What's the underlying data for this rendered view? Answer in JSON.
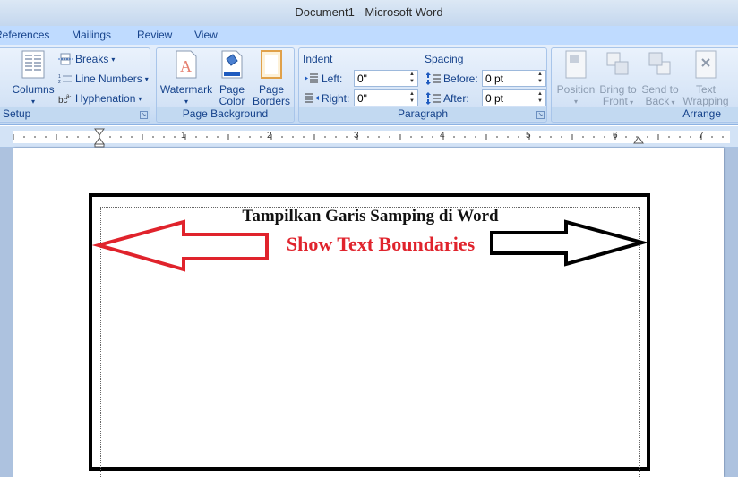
{
  "window": {
    "title": "Document1 - Microsoft Word"
  },
  "tabs": [
    "References",
    "Mailings",
    "Review",
    "View"
  ],
  "ribbon": {
    "page_setup": {
      "label": "Setup",
      "columns": "Columns",
      "breaks": "Breaks",
      "line_numbers": "Line Numbers",
      "hyphenation": "Hyphenation"
    },
    "page_background": {
      "label": "Page Background",
      "watermark": "Watermark",
      "page_color_1": "Page",
      "page_color_2": "Color",
      "page_borders_1": "Page",
      "page_borders_2": "Borders"
    },
    "paragraph": {
      "label": "Paragraph",
      "indent_heading": "Indent",
      "spacing_heading": "Spacing",
      "left_label": "Left:",
      "left_value": "0\"",
      "right_label": "Right:",
      "right_value": "0\"",
      "before_label": "Before:",
      "before_value": "0 pt",
      "after_label": "After:",
      "after_value": "0 pt"
    },
    "arrange": {
      "label": "Arrange",
      "position": "Position",
      "bring_to_front_1": "Bring to",
      "bring_to_front_2": "Front",
      "send_to_back_1": "Send to",
      "send_to_back_2": "Back",
      "text_wrapping_1": "Text",
      "text_wrapping_2": "Wrapping"
    }
  },
  "ruler": {
    "numbers": [
      "1",
      "2",
      "3",
      "4",
      "5",
      "6",
      "7"
    ]
  },
  "document": {
    "title": "Tampilkan Garis Samping di Word",
    "subtitle": "Show Text Boundaries"
  },
  "colors": {
    "accent_red": "#e0232c",
    "ribbon_blue": "#bfdbff",
    "text_blue": "#15428b"
  }
}
